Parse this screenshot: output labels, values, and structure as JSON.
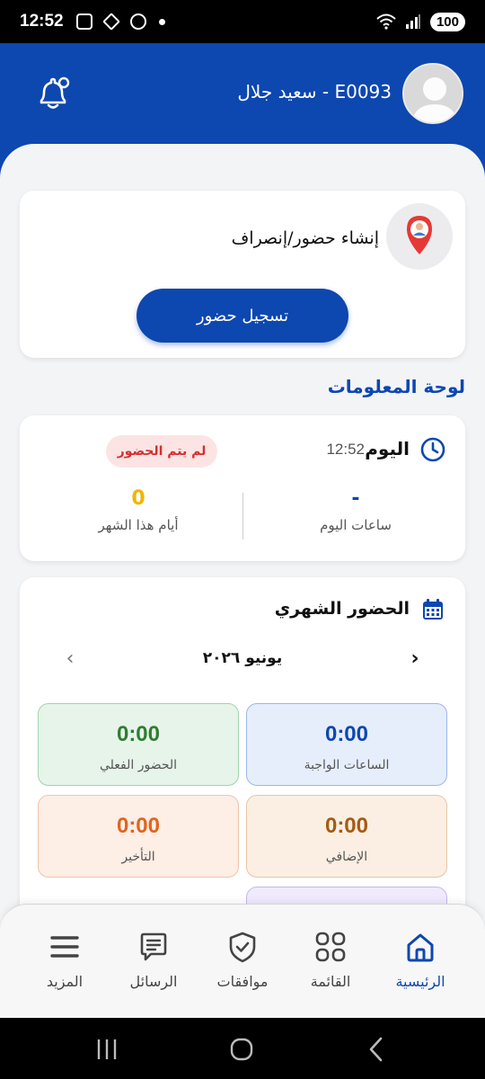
{
  "status_bar": {
    "time": "12:52",
    "battery": "100"
  },
  "header": {
    "user_name": "E0093 - سعيد جلال"
  },
  "attendance_card": {
    "title": "إنشاء حضور/إنصراف",
    "button_label": "تسجيل حضور"
  },
  "dashboard": {
    "section_title": "لوحة المعلومات"
  },
  "today_card": {
    "label": "اليوم",
    "time": "12:52",
    "status": "لم يتم الحضور",
    "hours_value": "-",
    "hours_label": "ساعات اليوم",
    "days_value": "0",
    "days_label": "أيام هذا الشهر"
  },
  "monthly_card": {
    "title": "الحضور الشهري",
    "month": "يونيو ٢٠٢٦",
    "tiles": [
      {
        "value": "0:00",
        "label": "الساعات الواجبة"
      },
      {
        "value": "0:00",
        "label": "الحضور الفعلي"
      },
      {
        "value": "0:00",
        "label": "الإضافي"
      },
      {
        "value": "0:00",
        "label": "التأخير"
      }
    ]
  },
  "bottom_nav": {
    "items": [
      {
        "label": "الرئيسية",
        "icon": "home-icon",
        "active": true
      },
      {
        "label": "القائمة",
        "icon": "grid-icon",
        "active": false
      },
      {
        "label": "موافقات",
        "icon": "shield-check-icon",
        "active": false
      },
      {
        "label": "الرسائل",
        "icon": "message-icon",
        "active": false
      },
      {
        "label": "المزيد",
        "icon": "menu-icon",
        "active": false
      }
    ]
  },
  "colors": {
    "primary": "#0d47b0",
    "status_red": "#d32f2f",
    "accent_yellow": "#f2b400"
  }
}
